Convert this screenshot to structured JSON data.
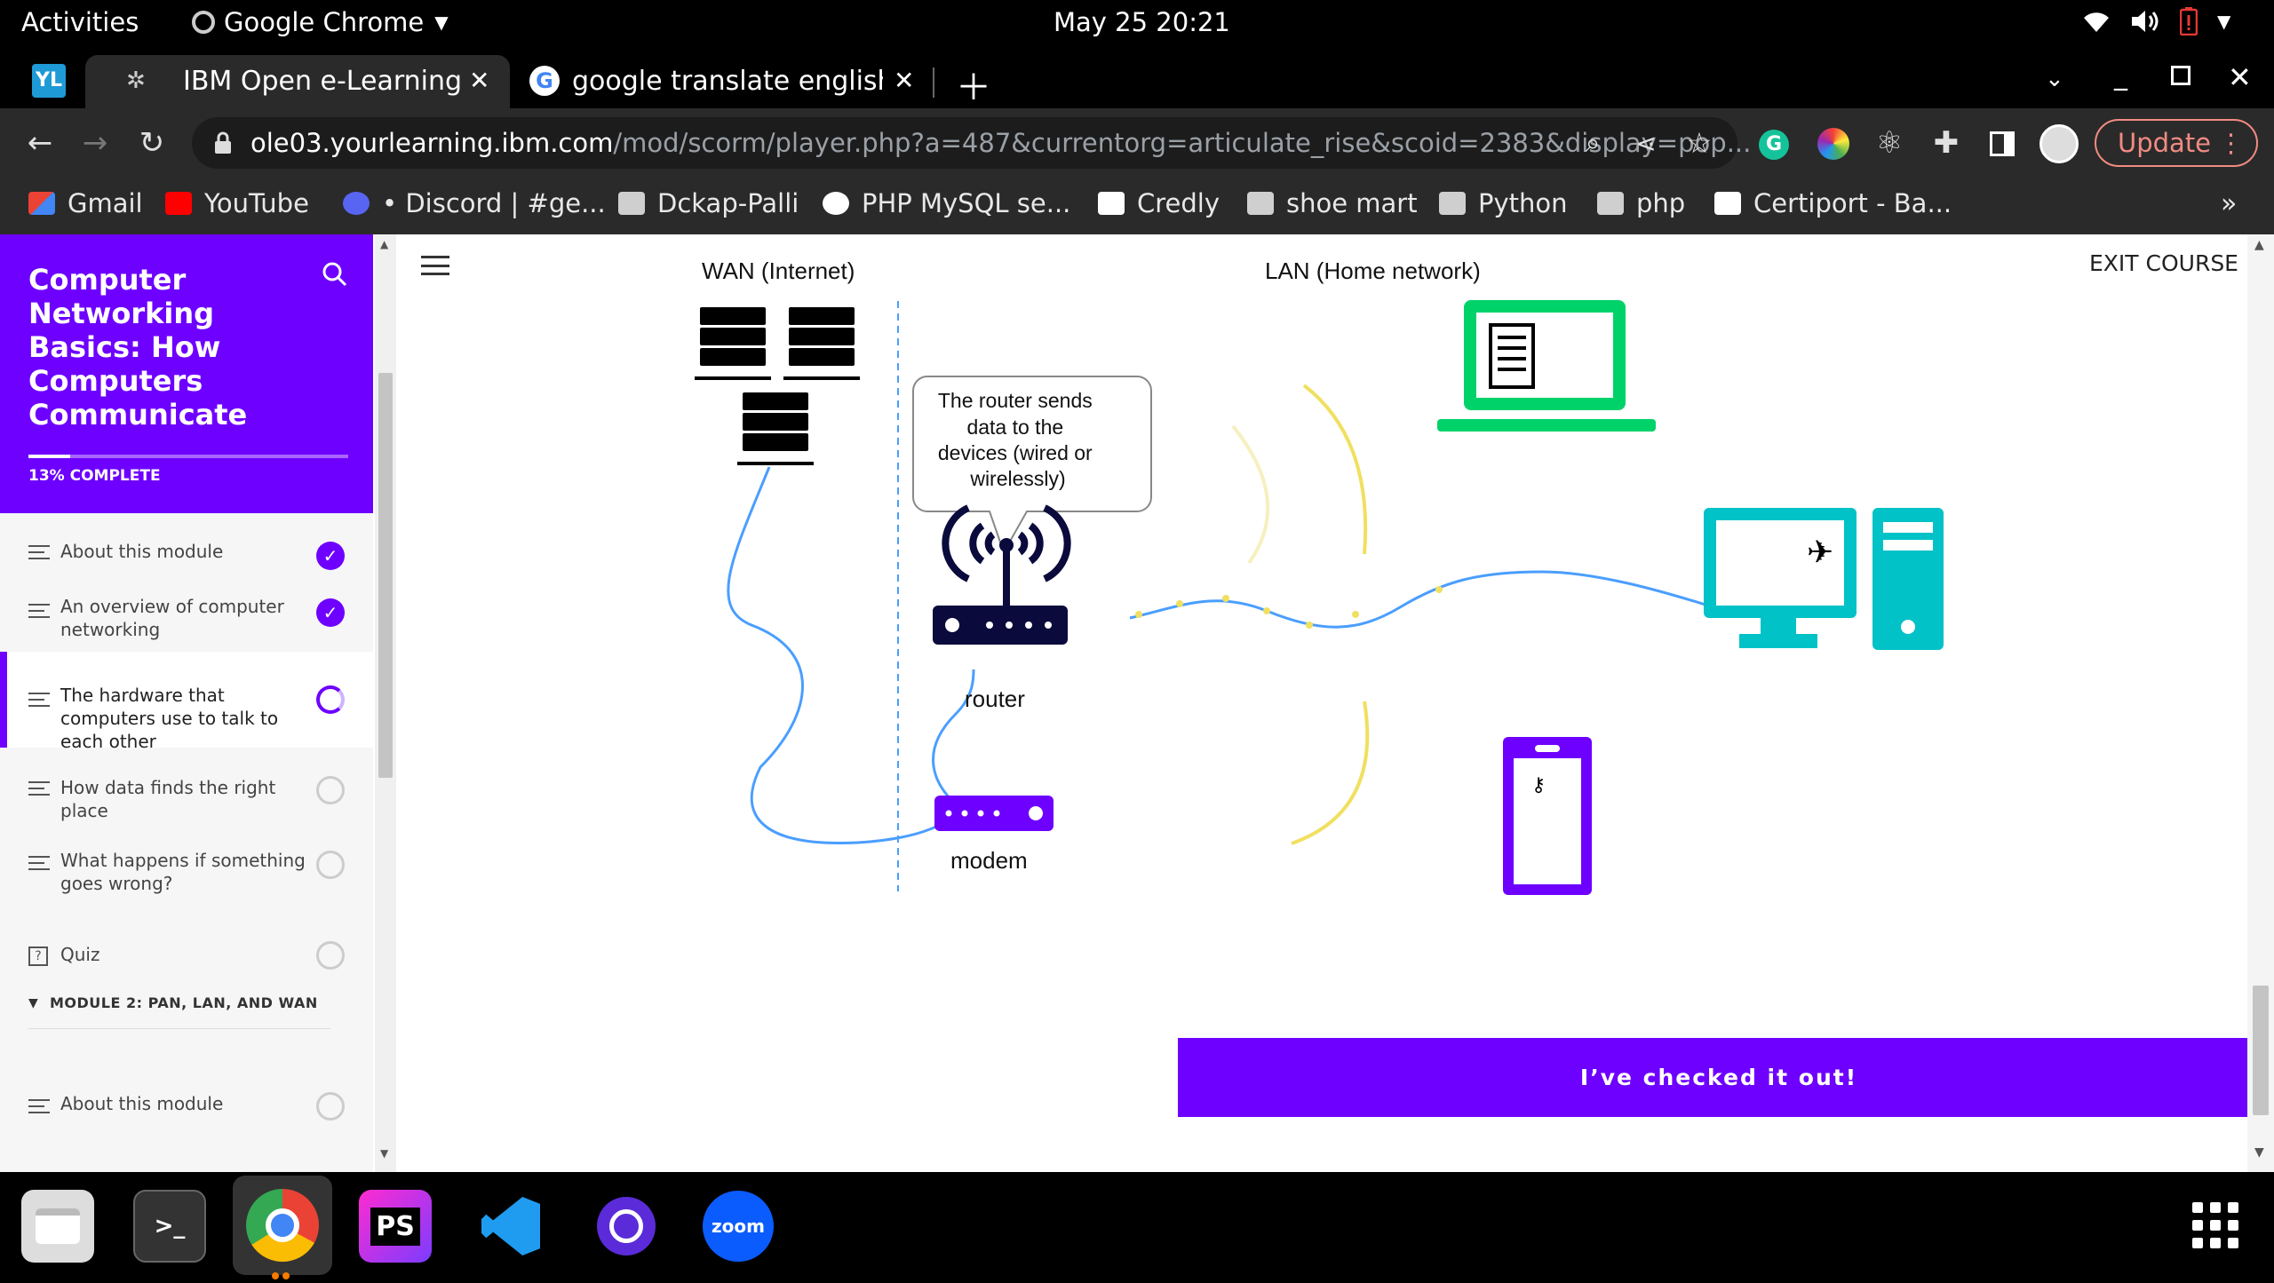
{
  "system": {
    "activities": "Activities",
    "app_name": "Google Chrome",
    "clock": "May 25  20:21"
  },
  "tabs": [
    {
      "title": "IBM Open e-Learning Eco",
      "active": true
    },
    {
      "title": "google translate english t",
      "active": false
    }
  ],
  "toolbar": {
    "url_host": "ole03.yourlearning.ibm.com",
    "url_path": "/mod/scorm/player.php?a=487&currentorg=articulate_rise&scoid=2383&display=pop...",
    "update_label": "Update"
  },
  "bookmarks": [
    {
      "label": "Gmail",
      "icon": "gmail-icon"
    },
    {
      "label": "YouTube",
      "icon": "youtube-icon"
    },
    {
      "label": "• Discord | #ge...",
      "icon": "discord-icon"
    },
    {
      "label": "Dckap-Palli",
      "icon": "folder-icon"
    },
    {
      "label": "PHP MySQL se...",
      "icon": "medium-icon"
    },
    {
      "label": "Credly",
      "icon": "credly-icon"
    },
    {
      "label": "shoe mart",
      "icon": "folder-icon"
    },
    {
      "label": "Python",
      "icon": "folder-icon"
    },
    {
      "label": "php",
      "icon": "folder-icon"
    },
    {
      "label": "Certiport - Ba...",
      "icon": "certiport-icon"
    }
  ],
  "course": {
    "title": "Computer Networking Basics: How Computers Communicate",
    "progress_label": "13% COMPLETE",
    "progress": 0.13,
    "exit_label": "EXIT COURSE"
  },
  "lessons": [
    {
      "label": "About this module",
      "status": "done"
    },
    {
      "label": "An overview of computer networking",
      "status": "done"
    },
    {
      "label": "The hardware that computers use to talk to each other",
      "status": "in-progress"
    },
    {
      "label": "How data finds the right place",
      "status": "todo"
    },
    {
      "label": "What happens if something goes wrong?",
      "status": "todo"
    },
    {
      "label": "Quiz",
      "status": "todo"
    }
  ],
  "module2": {
    "heading": "MODULE 2: PAN, LAN, AND WAN",
    "first_lesson": "About this module"
  },
  "diagram": {
    "wan_label": "WAN (Internet)",
    "lan_label": "LAN (Home network)",
    "callout": [
      "The router sends",
      "data to the",
      "devices (wired or",
      "wirelessly)"
    ],
    "router_label": "router",
    "modem_label": "modem"
  },
  "cta_label": "I’ve checked it out!",
  "colors": {
    "accent": "#6e00ff",
    "laptop": "#00d26a",
    "desktop": "#00c2c7",
    "device_dark": "#0a0a3c",
    "wifi": "#f0e060",
    "cable": "#4a9eff"
  }
}
